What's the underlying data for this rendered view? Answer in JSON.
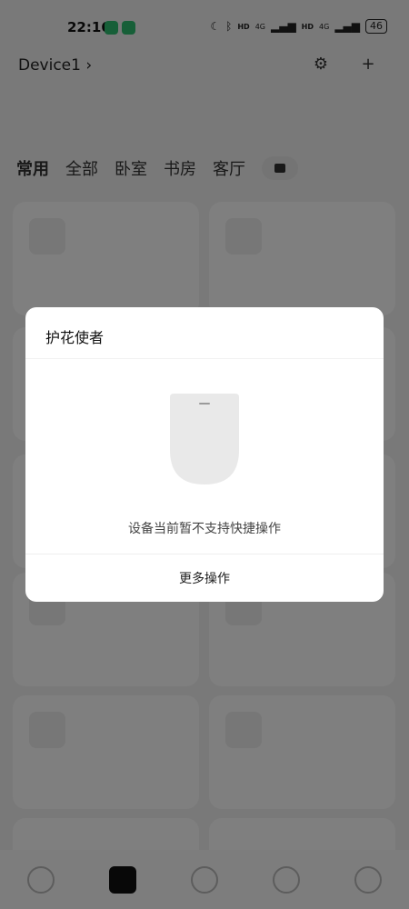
{
  "status_bar": {
    "time": "22:16",
    "signal1": "4G",
    "signal2": "4G",
    "hd1": "HD",
    "hd2": "HD",
    "battery": "46"
  },
  "background": {
    "home_title": "Device1 ›",
    "tabs": [
      "常用",
      "全部",
      "卧室",
      "书房",
      "客厅"
    ]
  },
  "dialog": {
    "title": "护花使者",
    "message": "设备当前暂不支持快捷操作",
    "action_label": "更多操作"
  }
}
